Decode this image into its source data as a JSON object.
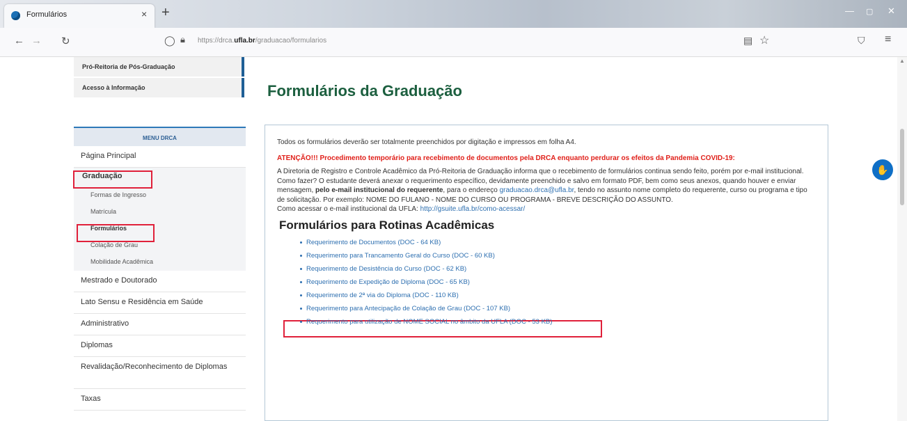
{
  "browser": {
    "tab_title": "Formulários",
    "tab_close": "×",
    "new_tab": "+",
    "url_prefix": "https://drca.",
    "url_domain": "ufla.br",
    "url_path": "/graduacao/formularios",
    "window_controls": {
      "minimize": "—",
      "maximize": "▢",
      "close": "✕"
    }
  },
  "sidebar": {
    "top_links": [
      "Pró-Reitoria de Pós-Graduação",
      "Acesso à Informação"
    ],
    "menu_header": "MENU DRCA",
    "home": "Página Principal",
    "graduacao": {
      "label": "Graduação",
      "children": [
        "Formas de Ingresso",
        "Matrícula",
        "Formulários",
        "Colação de Grau",
        "Mobilidade Acadêmica"
      ]
    },
    "items": [
      "Mestrado e Doutorado",
      "Lato Sensu e Residência em Saúde",
      "Administrativo",
      "Diplomas",
      "Revalidação/Reconhecimento de Diplomas",
      "Taxas"
    ]
  },
  "page": {
    "title": "Formulários da Graduação",
    "intro": "Todos os formulários deverão ser totalmente preenchidos por digitação e impressos em folha A4.",
    "warning": "ATENÇÃO!!! Procedimento temporário para recebimento de documentos pela DRCA enquanto perdurar os efeitos da Pandemia COVID-19:",
    "para1": "A Diretoria de Registro e Controle Acadêmico da Pró-Reitoria de Graduação informa que o recebimento de formulários continua sendo feito, porém por e-mail institucional.",
    "para2_a": "Como fazer? O estudante deverá anexar o requerimento específico, devidamente preenchido e salvo em formato PDF, bem como seus anexos, quando houver e enviar mensagem, ",
    "para2_bold": "pelo e-mail institucional do requerente",
    "para2_b": ", para o endereço ",
    "email": "graduacao.drca@ufla.br",
    "para2_c": ", tendo no assunto nome completo do requerente, curso ou programa e tipo de solicitação. Por exemplo: NOME DO FULANO - NOME DO CURSO OU PROGRAMA - BREVE DESCRIÇÃO DO ASSUNTO.",
    "para3_a": "Como acessar o e-mail institucional da UFLA: ",
    "para3_link": "http://gsuite.ufla.br/como-acessar/",
    "section_title": "Formulários para Rotinas Acadêmicas",
    "forms": [
      "Requerimento de Documentos (DOC - 64 KB)",
      "Requerimento para Trancamento Geral do Curso (DOC - 60 KB)",
      "Requerimento de Desistência do Curso (DOC - 62 KB)",
      "Requerimento de Expedição de Diploma (DOC - 65 KB)",
      "Requerimento de 2ª via do Diploma (DOC - 110 KB)",
      "Requerimento para Antecipação de Colação de Grau (DOC - 107 KB)",
      "Requerimento para utilização de NOME SOCIAL no âmbito da UFLA (DOC - 53 KB)"
    ]
  }
}
